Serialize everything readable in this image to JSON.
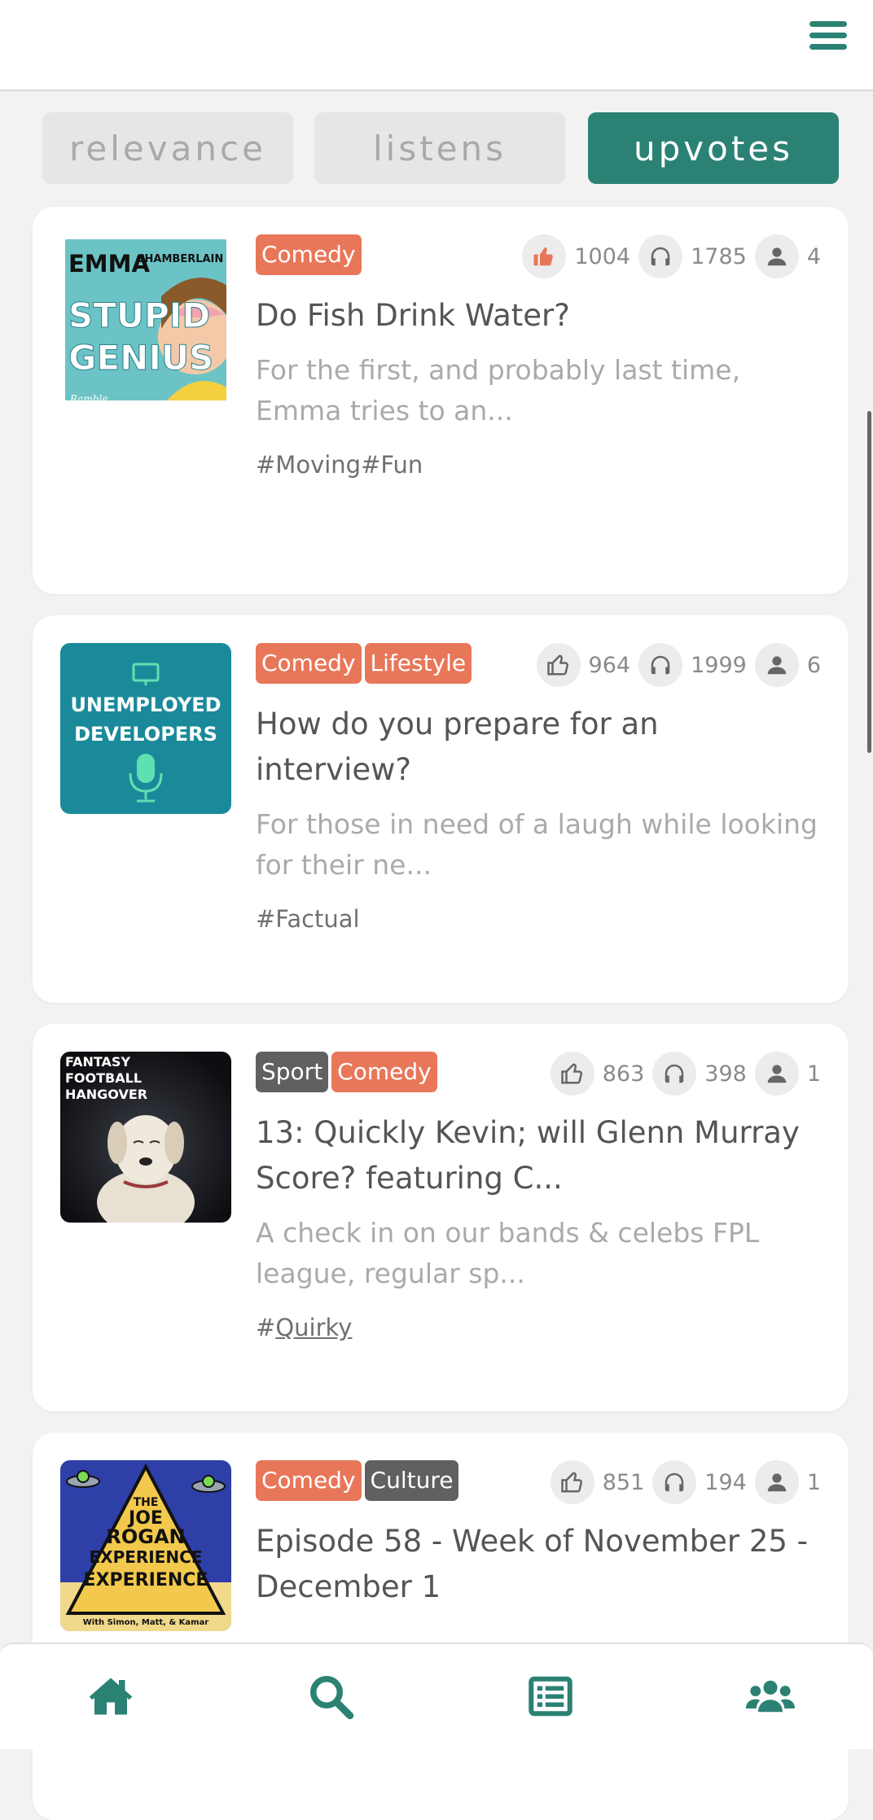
{
  "sort_tabs": [
    {
      "label": "relevance",
      "active": false
    },
    {
      "label": "listens",
      "active": false
    },
    {
      "label": "upvotes",
      "active": true
    }
  ],
  "icons": {
    "menu": "hamburger-menu-icon",
    "upvote": "thumbs-up-icon",
    "listens": "headphones-icon",
    "subscribers": "user-icon",
    "nav": [
      "home-icon",
      "search-icon",
      "list-icon",
      "users-icon"
    ]
  },
  "colors": {
    "accent": "#2b8274",
    "genre_orange": "#e8775a",
    "genre_grey": "#606060",
    "upvoted": "#e8775a"
  },
  "podcasts": [
    {
      "cover_text": [
        "EMMA",
        "CHAMBERLAIN",
        "STUPID",
        "GENIUS",
        "Ramble"
      ],
      "genres": [
        {
          "label": "Comedy",
          "color": "orange"
        }
      ],
      "upvotes": "1004",
      "listens": "1785",
      "subscribers": "4",
      "upvoted": true,
      "title": "Do Fish Drink Water?",
      "description": "For the first, and probably last time, Emma tries to an...",
      "hashtags": "#Moving#Fun"
    },
    {
      "cover_text": [
        "UNEMPLOYED",
        "DEVELOPERS"
      ],
      "genres": [
        {
          "label": "Comedy",
          "color": "orange"
        },
        {
          "label": "Lifestyle",
          "color": "orange"
        }
      ],
      "upvotes": "964",
      "listens": "1999",
      "subscribers": "6",
      "upvoted": false,
      "title": "How do you prepare for an interview?",
      "description": "For those in need of a laugh while looking for their ne...",
      "hashtags": "#Factual"
    },
    {
      "cover_text": [
        "FANTASY",
        "FOOTBALL",
        "HANGOVER"
      ],
      "genres": [
        {
          "label": "Sport",
          "color": "grey"
        },
        {
          "label": "Comedy",
          "color": "orange"
        }
      ],
      "upvotes": "863",
      "listens": "398",
      "subscribers": "1",
      "upvoted": false,
      "title": "13: Quickly Kevin; will Glenn Murray Score? featuring C...",
      "description": "A check in on our bands & celebs FPL league, regular sp...",
      "hashtag_prefix": "#",
      "hashtag_link": "Quirky"
    },
    {
      "cover_text": [
        "THE",
        "JOE",
        "ROGAN",
        "EXPERIENCE",
        "EXPERIENCE",
        "With Simon, Matt, & Kamar"
      ],
      "genres": [
        {
          "label": "Comedy",
          "color": "orange"
        },
        {
          "label": "Culture",
          "color": "grey"
        }
      ],
      "upvotes": "851",
      "listens": "194",
      "subscribers": "1",
      "upvoted": false,
      "title": "Episode 58 - Week of November 25 - December 1",
      "description": "",
      "hashtags": ""
    }
  ]
}
